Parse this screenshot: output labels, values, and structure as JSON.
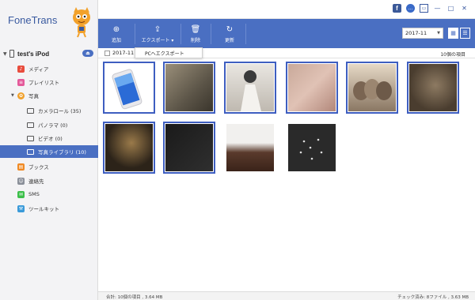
{
  "app": {
    "title": "FoneTrans"
  },
  "window_controls": [
    "f",
    "…",
    "▭",
    "—",
    "□",
    "✕"
  ],
  "device": {
    "name": "test's iPod",
    "eject": "⏏"
  },
  "nav": {
    "media": "メディア",
    "playlists": "プレイリスト",
    "photos": "写真",
    "camera_roll": "カメラロール (35)",
    "panorama": "パノラマ (0)",
    "video": "ビデオ (0)",
    "photo_library": "写真ライブラリ (10)",
    "books": "ブックス",
    "contacts": "連絡先",
    "sms": "SMS",
    "toolkit": "ツールキット"
  },
  "toolbar": {
    "add": "追加",
    "export": "エクスポート",
    "delete": "削除",
    "refresh": "更新",
    "date_value": "2017-11"
  },
  "export_menu": {
    "to_pc": "PCへエクスポート"
  },
  "group": {
    "date": "2017-11",
    "count": "10個の項目"
  },
  "status": {
    "left": "合計: 10個の項目 , 3.64 MB",
    "right": "チェック済み: 8ファイル , 3.63 MB"
  },
  "colors": {
    "accent": "#4a6fc2",
    "selection_border": "#3e5ec0"
  }
}
